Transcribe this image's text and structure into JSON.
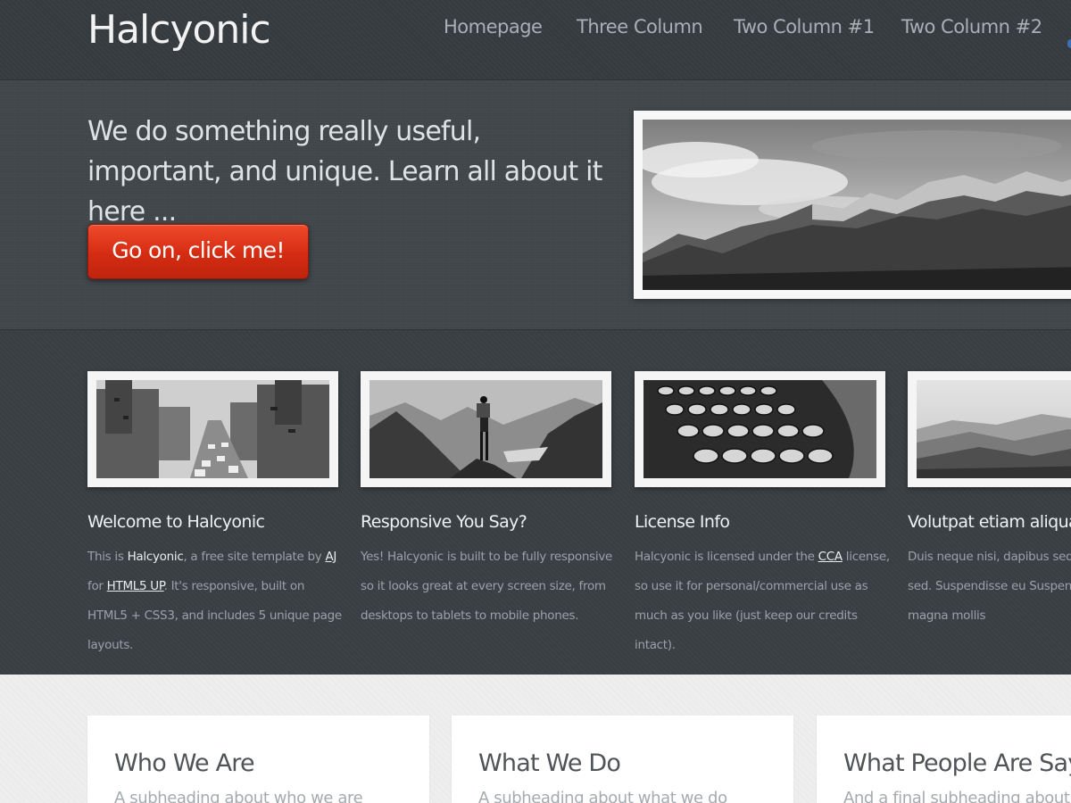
{
  "site": {
    "logo": "Halcyonic",
    "nav": [
      {
        "label": "Homepage"
      },
      {
        "label": "Three Column"
      },
      {
        "label": "Two Column #1"
      },
      {
        "label": "Two Column #2"
      }
    ]
  },
  "banner": {
    "tagline": "We do something really useful, important, and unique. Learn all about it here ...",
    "cta_label": "Go on, click me!",
    "image": "mountain-range-photo"
  },
  "features": [
    {
      "image": "city-traffic-photo",
      "title": "Welcome to Halcyonic",
      "text_before": "This is ",
      "strong": "Halcyonic",
      "text_mid": ", a free site template by ",
      "link1": "AJ",
      "text_mid2": " for ",
      "link2": "HTML5 UP",
      "text_after": ". It's responsive, built on HTML5 + CSS3, and includes 5 unique page layouts."
    },
    {
      "image": "hiker-mountain-photo",
      "title": "Responsive You Say?",
      "text": "Yes! Halcyonic is built to be fully responsive so it looks great at every screen size, from desktops to tablets to mobile phones."
    },
    {
      "image": "typewriter-keys-photo",
      "title": "License Info",
      "text_before": "Halcyonic is licensed under the ",
      "link1": "CCA",
      "text_after": " license, so use it for personal/commercial use as much as you like (just keep our credits intact)."
    },
    {
      "image": "valley-hills-photo",
      "title": "Volutpat etiam aliquam",
      "text": "Duis neque nisi, dapibus sed ma accumsan sed. Suspendisse eu Suspendisse vitae magna mollis"
    }
  ],
  "cards": [
    {
      "title": "Who We Are",
      "subheading": "A subheading about who we are"
    },
    {
      "title": "What We Do",
      "subheading": "A subheading about what we do"
    },
    {
      "title": "What People Are Saying",
      "subheading": "And a final subheading about our c"
    }
  ]
}
